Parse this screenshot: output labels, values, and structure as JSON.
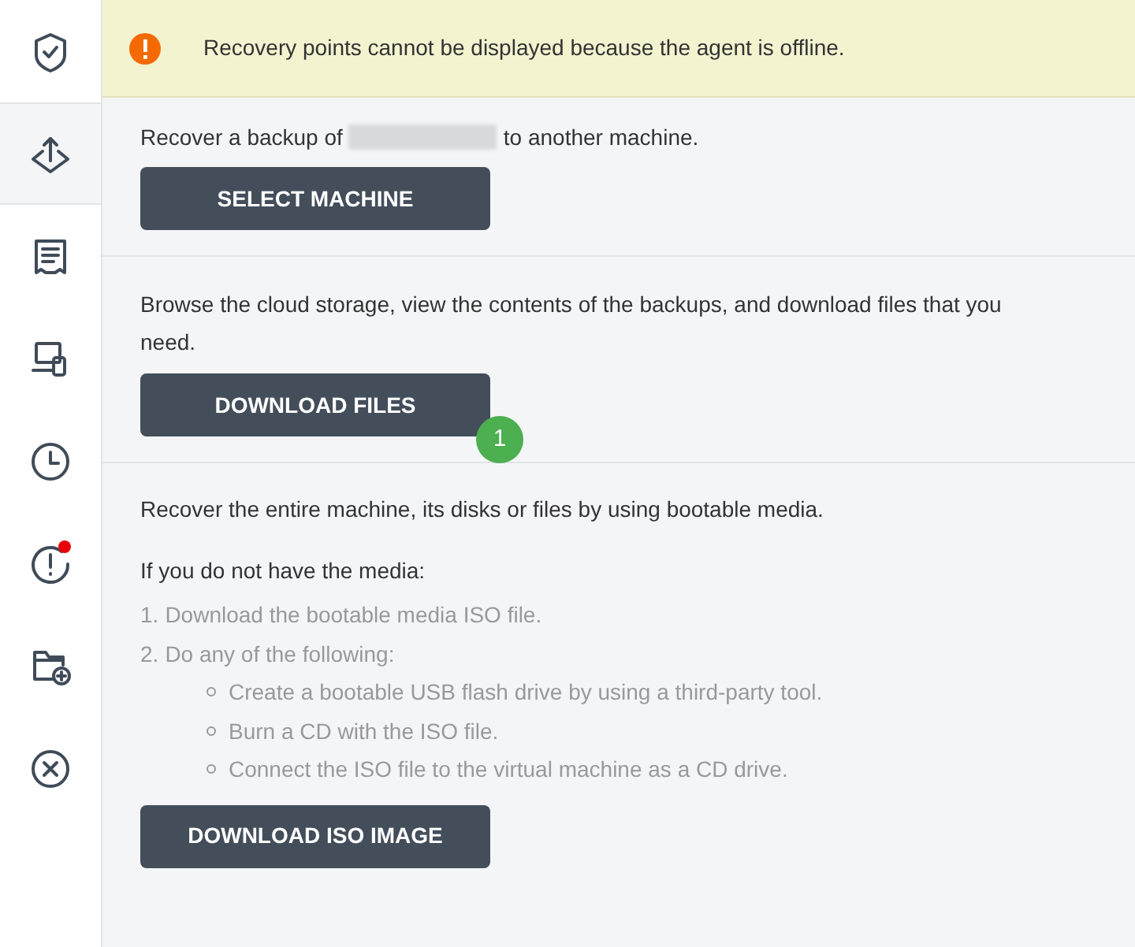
{
  "sidebar": {
    "items": [
      {
        "kind": "shield",
        "selected": false,
        "dot": false
      },
      {
        "kind": "recover",
        "selected": true,
        "dot": false
      },
      {
        "kind": "report",
        "selected": false,
        "dot": false
      },
      {
        "kind": "devices",
        "selected": false,
        "dot": false
      },
      {
        "kind": "clock",
        "selected": false,
        "dot": false
      },
      {
        "kind": "alert",
        "selected": false,
        "dot": true
      },
      {
        "kind": "folder-add",
        "selected": false,
        "dot": false
      },
      {
        "kind": "cancel",
        "selected": false,
        "dot": false
      }
    ]
  },
  "banner": {
    "text": "Recovery points cannot be displayed because the agent is offline."
  },
  "sections": [
    {
      "kind": "machine",
      "text_before": "Recover a backup of",
      "text_after": "to another machine.",
      "button": "SELECT MACHINE"
    },
    {
      "kind": "files",
      "text": "Browse the cloud storage, view the contents of the backups, and download files that you need.",
      "button": "DOWNLOAD FILES",
      "badge": "1"
    },
    {
      "kind": "media",
      "text": "Recover the entire machine, its disks or files by using bootable media.",
      "subheading": "If you do not have the media:",
      "steps": [
        {
          "number": "1.",
          "text": "Download the bootable media ISO file."
        },
        {
          "number": "2.",
          "text": "Do any of the following:",
          "children": [
            {
              "text": "Create a bootable USB flash drive by using a third-party tool."
            },
            {
              "text": "Burn a CD with the ISO file."
            },
            {
              "text": "Connect the ISO file to the virtual machine as a CD drive."
            }
          ]
        }
      ],
      "button": "DOWNLOAD ISO IMAGE"
    }
  ]
}
